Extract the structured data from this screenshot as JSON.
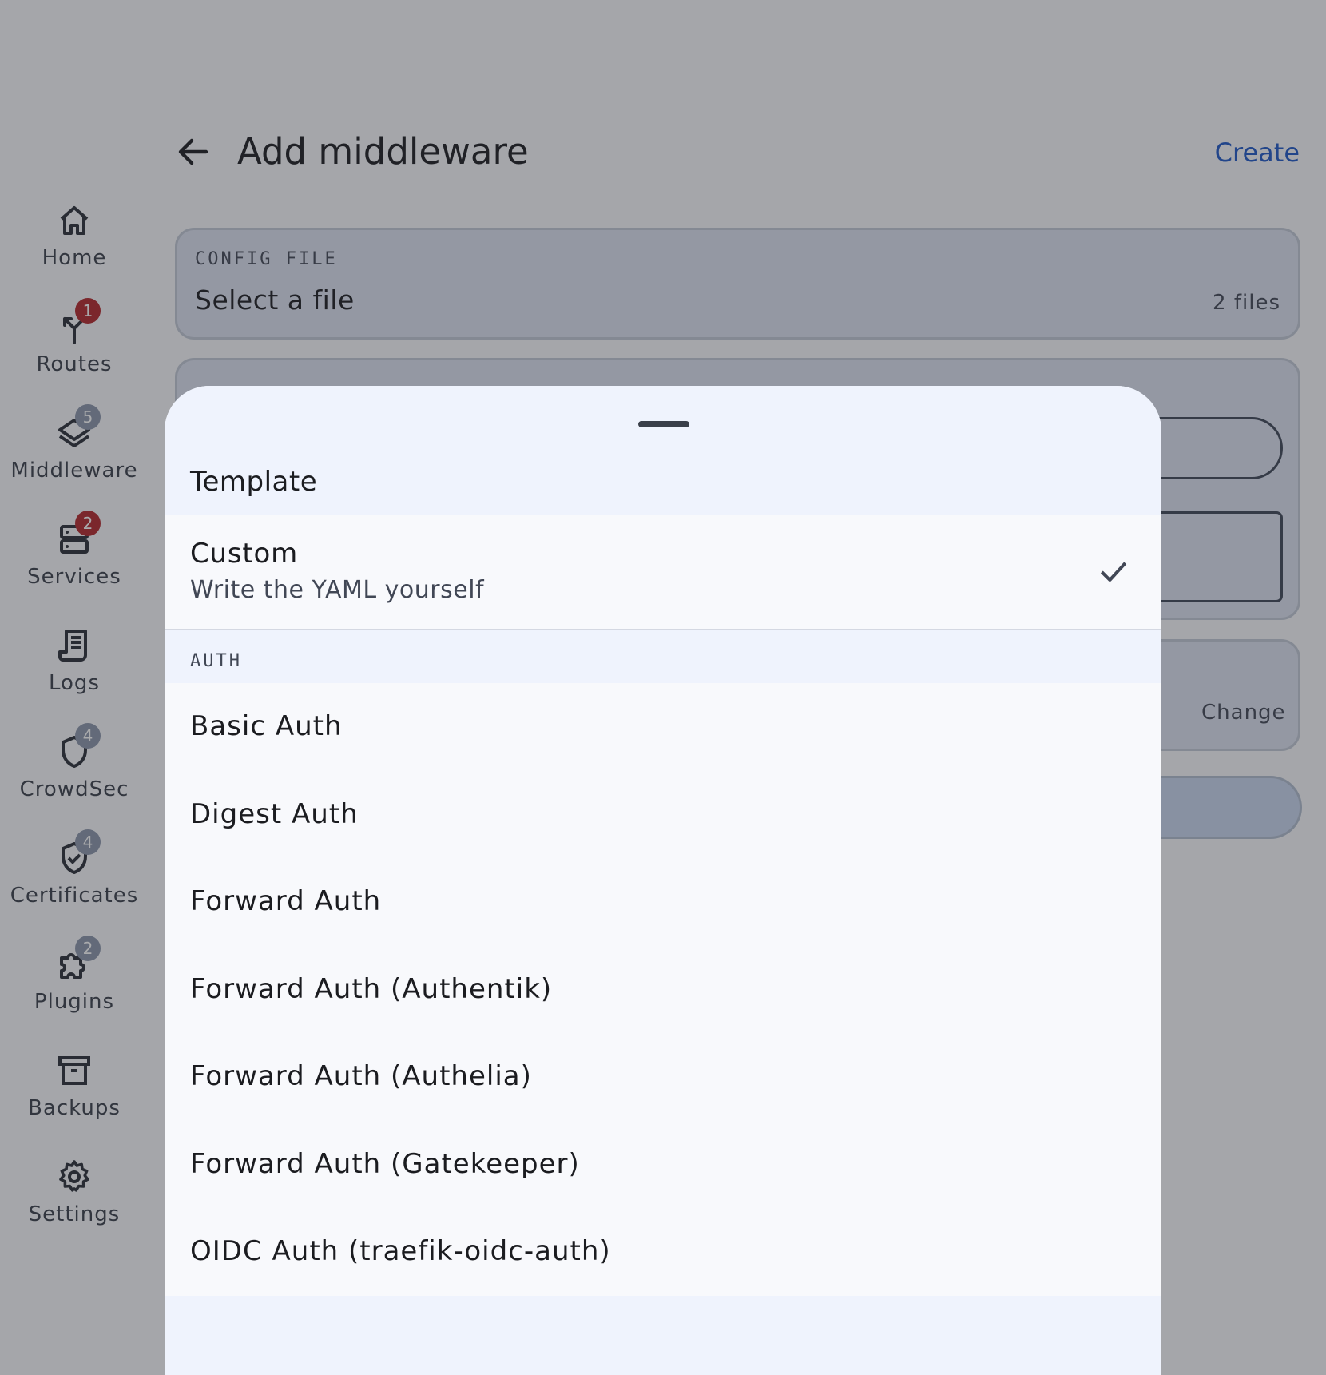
{
  "navigation_rail": {
    "items": [
      {
        "label": "Home",
        "icon": "home-icon",
        "badge": ""
      },
      {
        "label": "Routes",
        "icon": "routes-icon",
        "badge": "1"
      },
      {
        "label": "Middleware",
        "icon": "layers-icon",
        "badge": "5"
      },
      {
        "label": "Services",
        "icon": "server-icon",
        "badge": "2"
      },
      {
        "label": "Logs",
        "icon": "logs-icon",
        "badge": ""
      },
      {
        "label": "CrowdSec",
        "icon": "shield-icon",
        "badge": "4"
      },
      {
        "label": "Certificates",
        "icon": "verified-shield-icon",
        "badge": "4"
      },
      {
        "label": "Plugins",
        "icon": "puzzle-icon",
        "badge": "2"
      },
      {
        "label": "Backups",
        "icon": "archive-icon",
        "badge": ""
      },
      {
        "label": "Settings",
        "icon": "gear-icon",
        "badge": ""
      }
    ]
  },
  "appbar": {
    "title": "Add middleware",
    "action": "Create"
  },
  "form": {
    "config_file": {
      "overline": "CONFIG FILE",
      "value": "Select a file",
      "trailing": "2 files"
    },
    "change_label": "Change"
  },
  "sheet": {
    "title": "Template",
    "selected_option": {
      "title": "Custom",
      "subtitle": "Write the YAML yourself"
    },
    "sections": [
      {
        "label": "AUTH",
        "items": [
          "Basic Auth",
          "Digest Auth",
          "Forward Auth",
          "Forward Auth (Authentik)",
          "Forward Auth (Authelia)",
          "Forward Auth (Gatekeeper)",
          "OIDC Auth (traefik-oidc-auth)"
        ]
      }
    ]
  },
  "colors": {
    "accent": "#1f58c7",
    "badge_error": "#b3262b",
    "badge_muted": "#8b95aa",
    "sheet_header": "#eff3fd"
  }
}
